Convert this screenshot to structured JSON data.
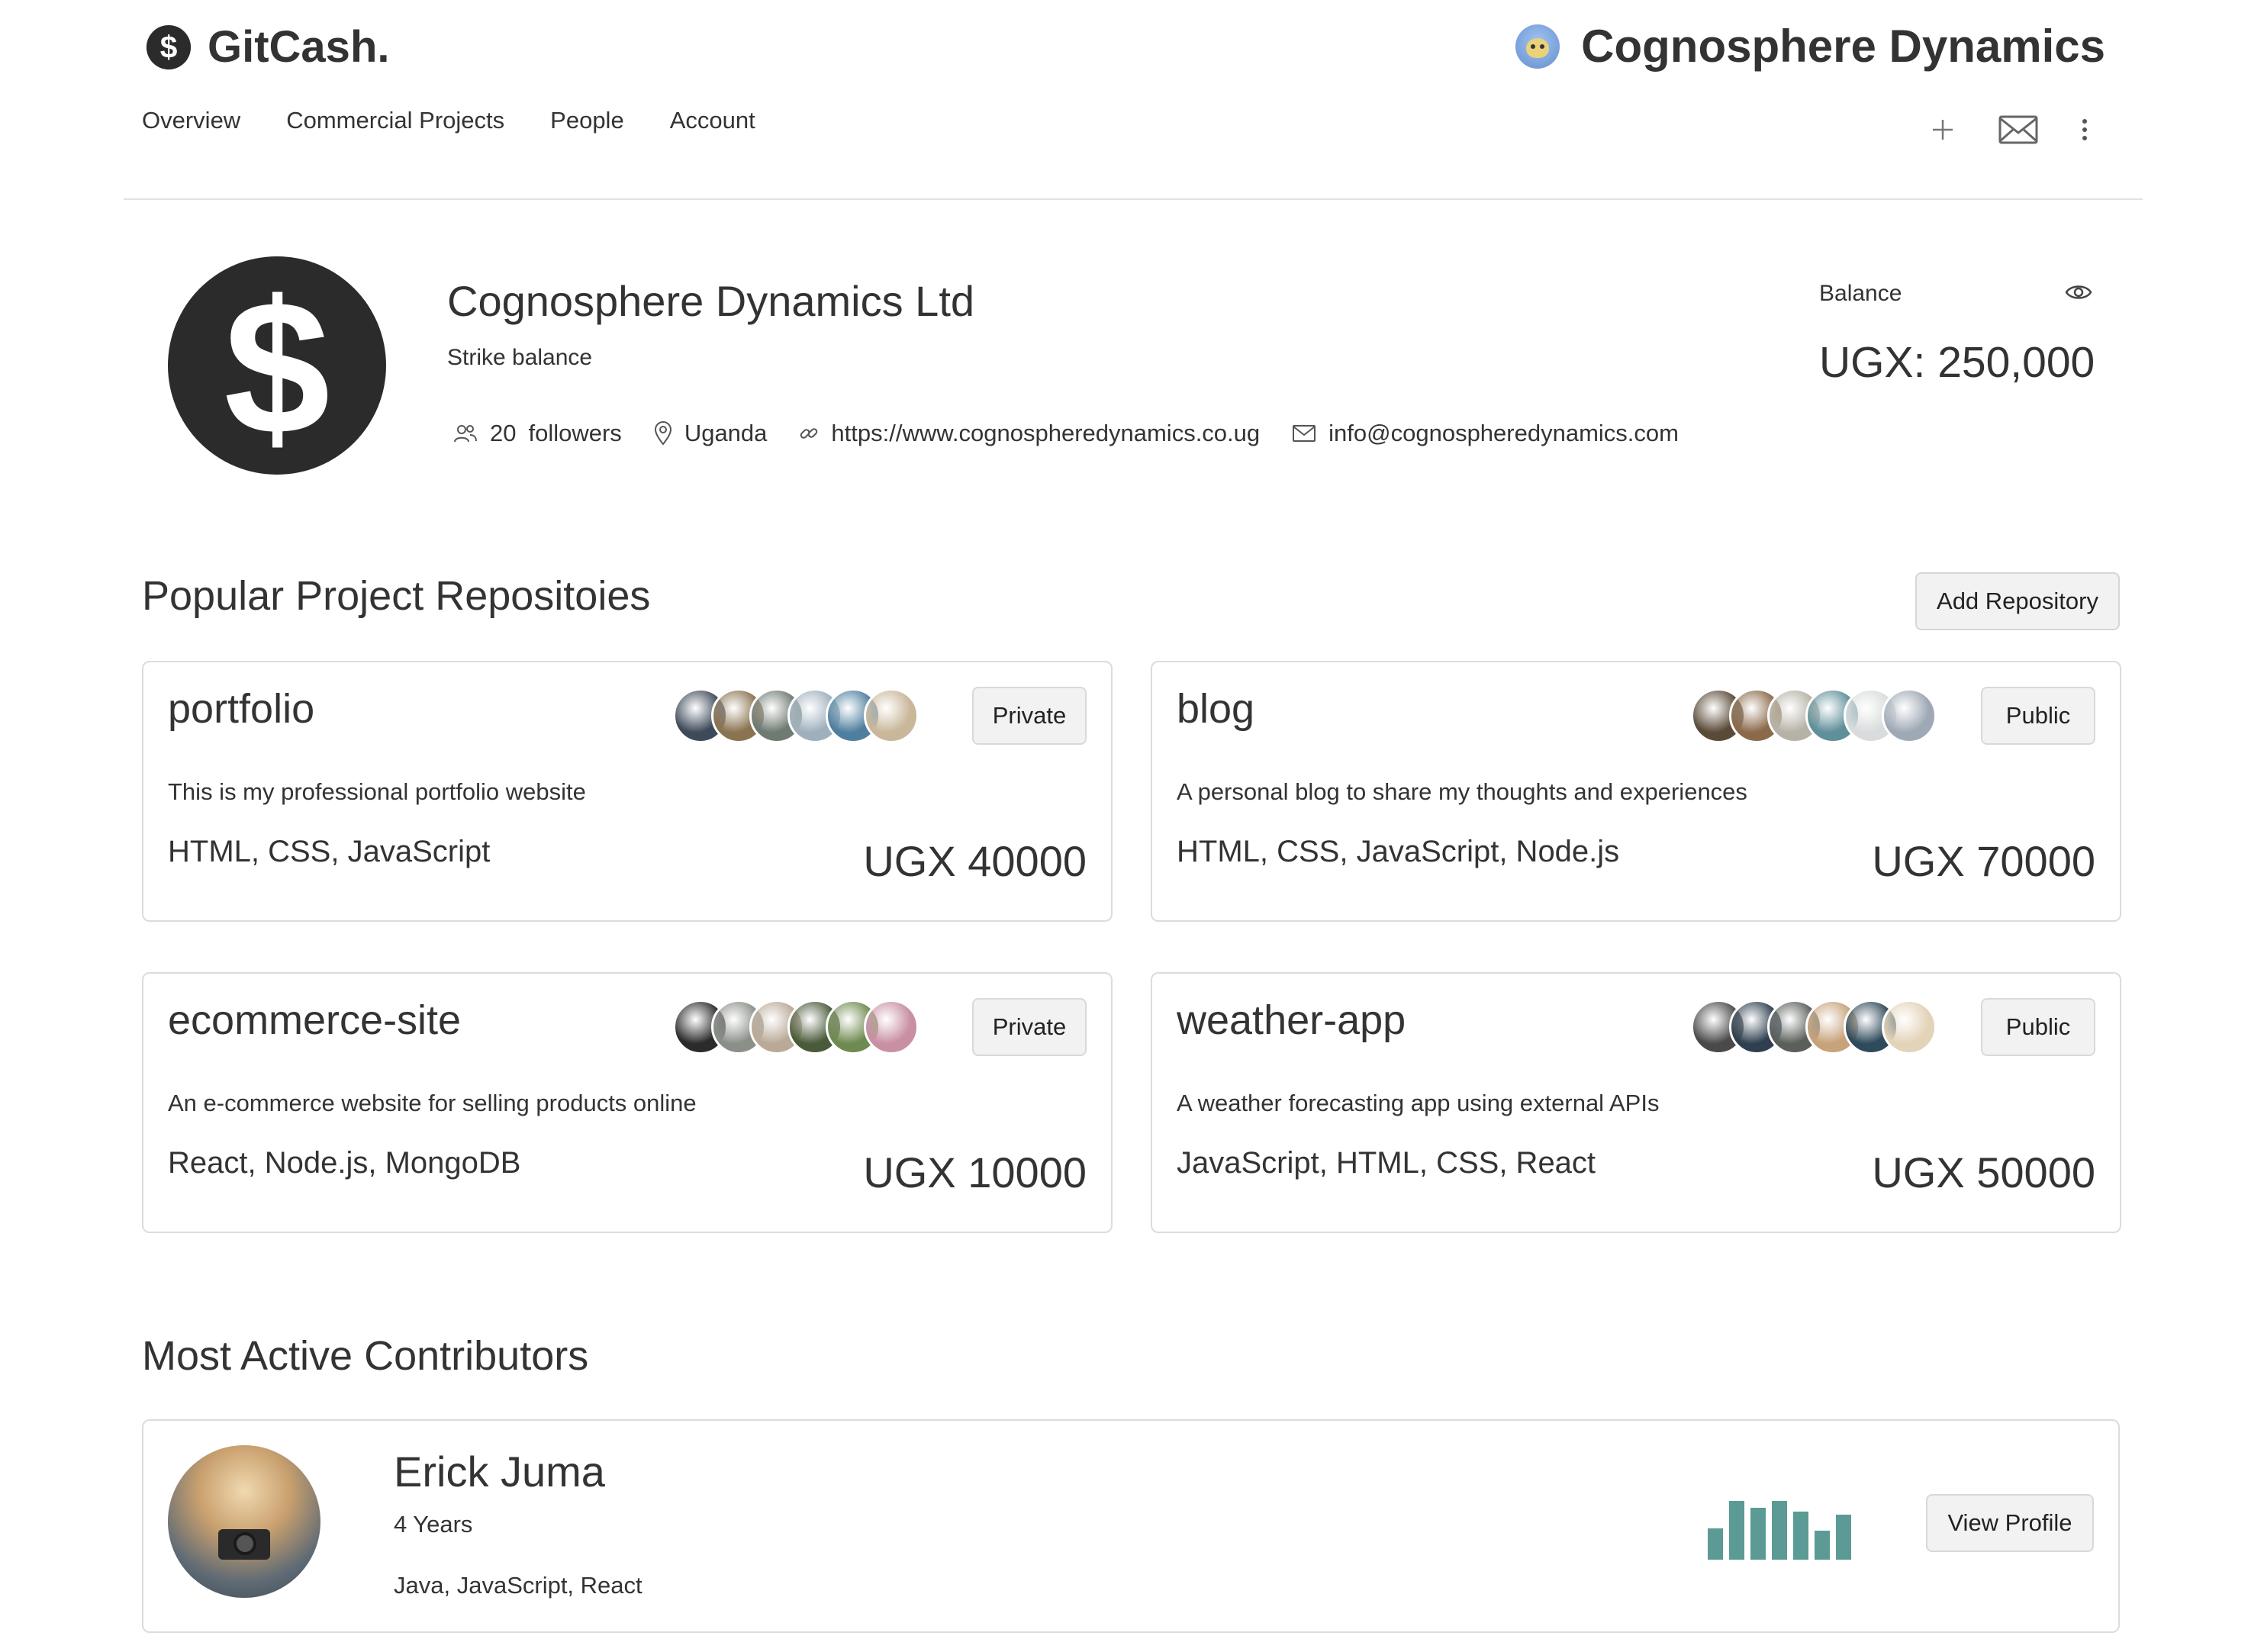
{
  "brand": {
    "name": "GitCash.",
    "icon": "dollar-coin-icon"
  },
  "company": {
    "title": "Cognosphere Dynamics",
    "avatar": "emoji-avatar"
  },
  "nav": [
    {
      "label": "Overview"
    },
    {
      "label": "Commercial Projects"
    },
    {
      "label": "People"
    },
    {
      "label": "Account"
    }
  ],
  "header_actions": {
    "add": "plus-icon",
    "mail": "envelope-icon",
    "more": "kebab-menu-icon"
  },
  "profile": {
    "name": "Cognosphere Dynamics Ltd",
    "subtitle": "Strike balance",
    "followers_count": "20",
    "followers_label": "followers",
    "location": "Uganda",
    "website": "https://www.cognospheredynamics.co.ug",
    "email": "info@cognospheredynamics.com",
    "balance_label": "Balance",
    "balance_value": "UGX: 250,000"
  },
  "repos_section": {
    "title": "Popular Project Repositoies",
    "add_button": "Add Repository"
  },
  "repos": [
    {
      "name": "portfolio",
      "visibility": "Private",
      "description": "This is my professional portfolio website",
      "tech": "HTML, CSS, JavaScript",
      "price": "UGX 40000",
      "avatar_colors": [
        "#3e4a5a",
        "#8a7350",
        "#6f7a72",
        "#9fb0bd",
        "#4f7f9f",
        "#c9b79a"
      ]
    },
    {
      "name": "blog",
      "visibility": "Public",
      "description": "A personal blog to share my thoughts and experiences",
      "tech": "HTML, CSS, JavaScript, Node.js",
      "price": "UGX 70000",
      "avatar_colors": [
        "#5a4a38",
        "#8a6a4a",
        "#b7b2a7",
        "#5f8f9a",
        "#d9dcdc",
        "#9fa9b6"
      ]
    },
    {
      "name": "ecommerce-site",
      "visibility": "Private",
      "description": "An e-commerce website for selling products online",
      "tech": "React, Node.js, MongoDB",
      "price": "UGX 10000",
      "avatar_colors": [
        "#2b2b2b",
        "#8a8f88",
        "#b9a996",
        "#4a5a3a",
        "#6f8a50",
        "#c98fa3"
      ]
    },
    {
      "name": "weather-app",
      "visibility": "Public",
      "description": "A weather forecasting app using external APIs",
      "tech": "JavaScript, HTML, CSS, React",
      "price": "UGX 50000",
      "avatar_colors": [
        "#4a4a4a",
        "#2f3f4f",
        "#5a5f5a",
        "#c7a27a",
        "#2f4a5a",
        "#e3d3b8"
      ]
    }
  ],
  "contributors_section": {
    "title": "Most Active Contributors"
  },
  "contributor": {
    "name": "Erick Juma",
    "years": "4 Years",
    "skills": "Java, JavaScript, React",
    "button": "View Profile",
    "activity": [
      0.45,
      0.85,
      0.75,
      0.85,
      0.7,
      0.42,
      0.65
    ],
    "activity_color": "#5b9a95"
  }
}
